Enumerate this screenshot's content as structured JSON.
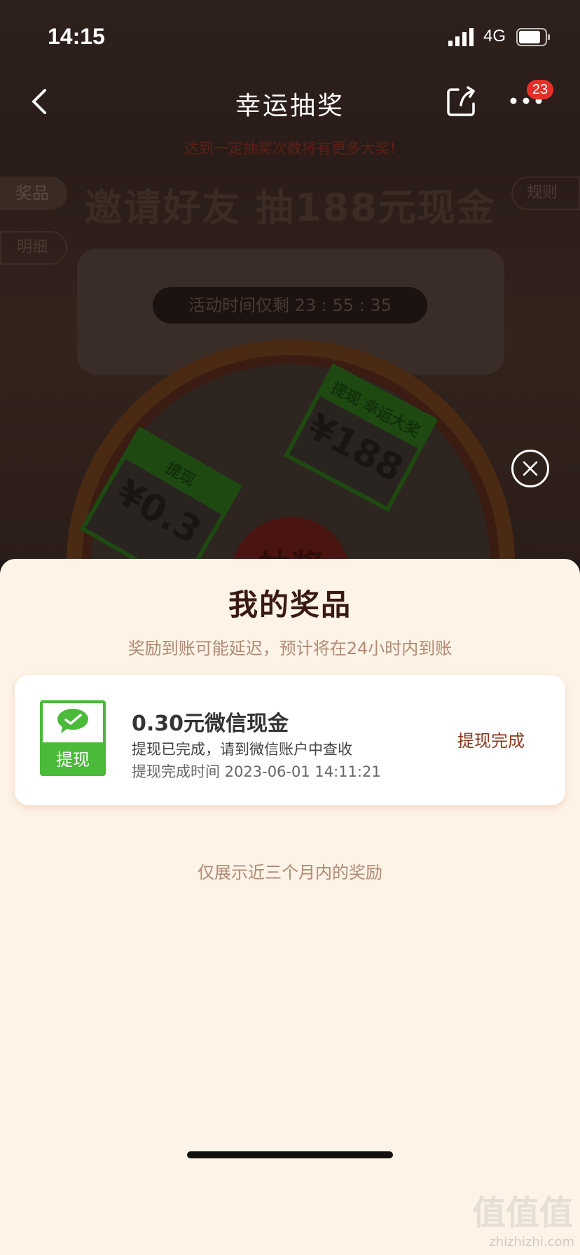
{
  "status_bar": {
    "time": "14:15",
    "network": "4G"
  },
  "nav": {
    "title": "幸运抽奖",
    "badge_count": "23"
  },
  "background": {
    "subtitle": "达到一定抽奖次数将有更多大奖!",
    "tabs": {
      "prizes": "奖品",
      "details": "明细",
      "rules": "规则"
    },
    "headline": "邀请好友 抽188元现金",
    "countdown": "活动时间仅剩 23 : 55 : 35",
    "wheel_items": [
      {
        "label": "提现",
        "value": "¥0.3"
      },
      {
        "label": "提现 幸运大奖",
        "value": "¥188"
      }
    ],
    "center_button": "抽奖"
  },
  "sheet": {
    "title": "我的奖品",
    "subtitle": "奖励到账可能延迟，预计将在24小时内到账",
    "prizes": [
      {
        "icon_label": "提现",
        "name": "0.30元微信现金",
        "desc": "提现已完成，请到微信账户中查收",
        "time": "提现完成时间 2023-06-01 14:11:21",
        "status": "提现完成"
      }
    ],
    "footnote": "仅展示近三个月内的奖励"
  },
  "watermark": {
    "big": "值值值",
    "small": "zhizhizhi.com"
  }
}
